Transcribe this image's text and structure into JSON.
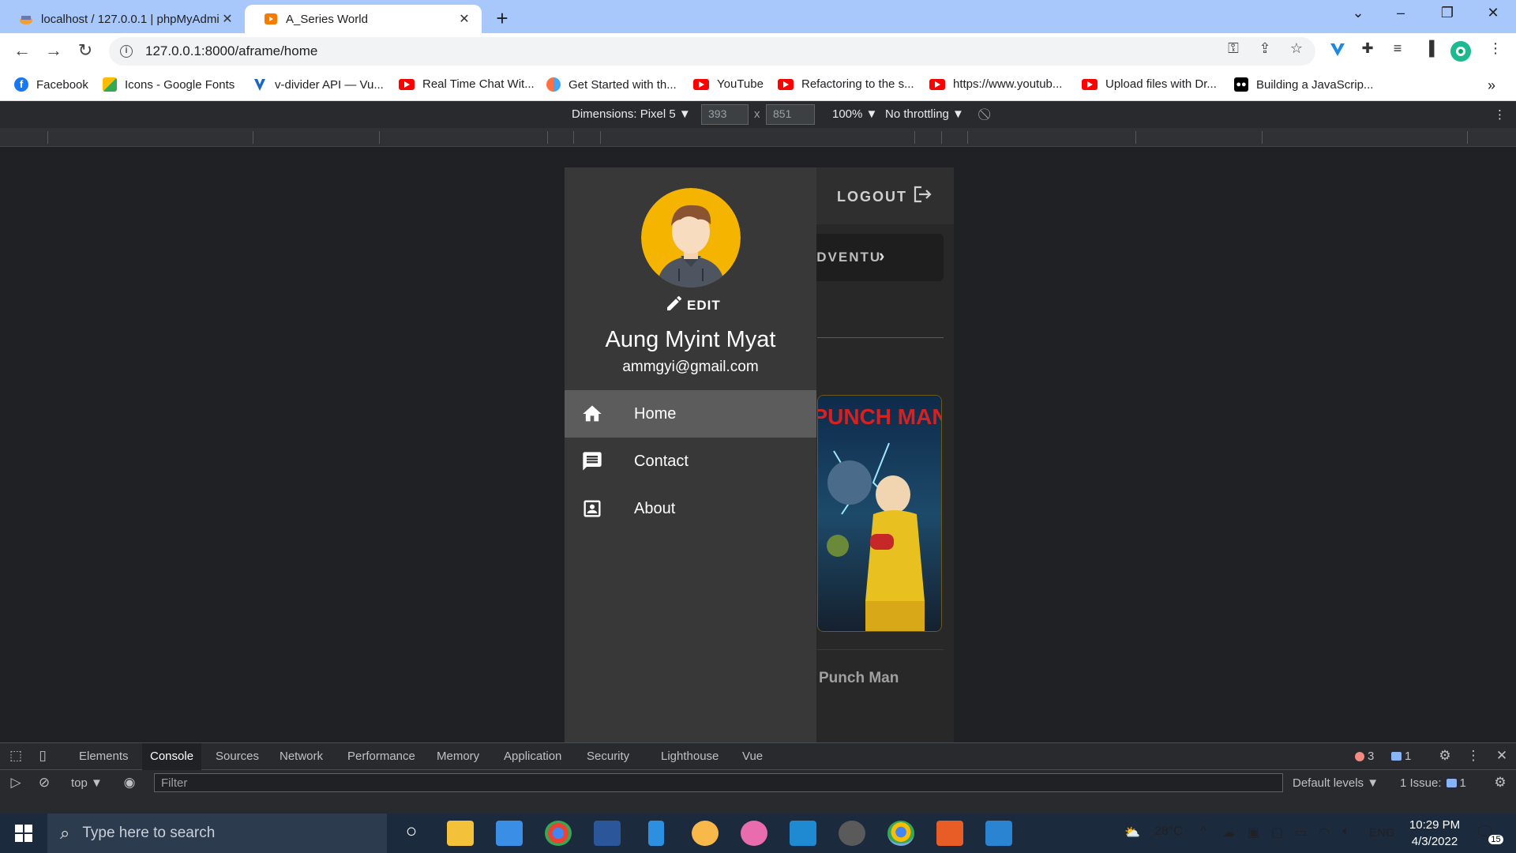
{
  "browser": {
    "tabs": [
      {
        "title": "localhost / 127.0.0.1 | phpMyAdmin",
        "active": false
      },
      {
        "title": "A_Series World",
        "active": true
      }
    ],
    "url": "127.0.0.1:8000/aframe/home",
    "bookmarks": [
      {
        "label": "Facebook",
        "icon": "facebook-icon",
        "color": "#1877f2"
      },
      {
        "label": "Icons - Google Fonts",
        "icon": "google-fonts-icon",
        "color": "#fbbc04"
      },
      {
        "label": "v-divider API — Vu...",
        "icon": "vuetify-icon",
        "color": "#1867c0"
      },
      {
        "label": "Real Time Chat Wit...",
        "icon": "youtube-icon",
        "color": "#ff0000"
      },
      {
        "label": "Get Started with th...",
        "icon": "bookmark-icon",
        "color": "#ff7043"
      },
      {
        "label": "YouTube",
        "icon": "youtube-icon",
        "color": "#ff0000"
      },
      {
        "label": "Refactoring to the s...",
        "icon": "youtube-icon",
        "color": "#ff0000"
      },
      {
        "label": "https://www.youtub...",
        "icon": "youtube-icon",
        "color": "#ff0000"
      },
      {
        "label": "Upload files with Dr...",
        "icon": "youtube-icon",
        "color": "#ff0000"
      },
      {
        "label": "Building a JavaScrip...",
        "icon": "medium-icon",
        "color": "#000000"
      }
    ],
    "more_bookmarks": "»"
  },
  "device_toolbar": {
    "dimensions_label": "Dimensions: Pixel 5 ▼",
    "width": "393",
    "height": "851",
    "times": "x",
    "zoom": "100% ▼",
    "throttling": "No throttling ▼"
  },
  "app": {
    "logout_label": "LOGOUT",
    "category_chip": "ADVENTU",
    "card_title": "Punch Man",
    "poster_text": "PUNCH MAN",
    "drawer": {
      "edit_label": "EDIT",
      "user_name": "Aung Myint Myat",
      "user_email": "ammgyi@gmail.com",
      "items": [
        {
          "label": "Home",
          "icon": "home-icon",
          "active": true
        },
        {
          "label": "Contact",
          "icon": "message-icon",
          "active": false
        },
        {
          "label": "About",
          "icon": "account-box-icon",
          "active": false
        }
      ]
    },
    "colors": {
      "drawer": "#383838",
      "active_item": "#5c5c5c",
      "avatar_bg": "#f5b400"
    }
  },
  "devtools": {
    "tabs": [
      "Elements",
      "Console",
      "Sources",
      "Network",
      "Performance",
      "Memory",
      "Application",
      "Security",
      "Lighthouse",
      "Vue"
    ],
    "active_tab": "Console",
    "errors_count": "3",
    "messages_count": "1",
    "context": "top ▼",
    "filter_placeholder": "Filter",
    "levels": "Default levels ▼",
    "issues_label": "1 Issue:",
    "issues_count": "1"
  },
  "taskbar": {
    "search_placeholder": "Type here to search",
    "weather": "28°C",
    "language": "ENG",
    "time": "10:29 PM",
    "date": "4/3/2022",
    "notifications": "15"
  }
}
